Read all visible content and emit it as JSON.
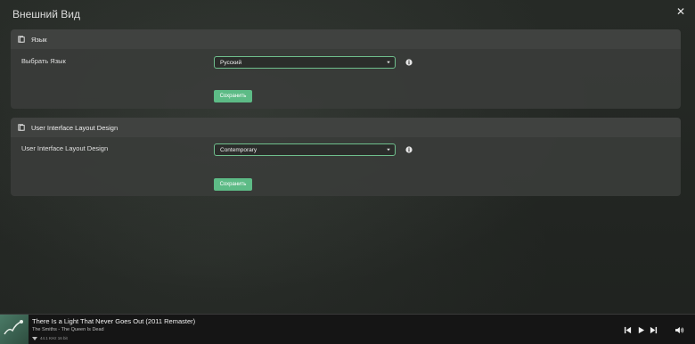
{
  "window": {
    "title": "Внешний Вид"
  },
  "language_panel": {
    "heading": "Язык",
    "field_label": "Выбрать Язык",
    "selected": "Русский",
    "save_label": "Сохранить"
  },
  "layout_panel": {
    "heading": "User Interface Layout Design",
    "field_label": "User Interface Layout Design",
    "selected": "Contemporary",
    "save_label": "Сохранить"
  },
  "player": {
    "track_title": "There Is a Light That Never Goes Out (2011 Remaster)",
    "artist_album": "The Smiths - The Queen Is Dead",
    "format": "44.1 KHz 16 bit"
  },
  "icons": {
    "close": "close-icon",
    "panel": "book-icon",
    "chevron": "chevron-down-icon",
    "info": "info-icon",
    "prev": "previous-icon",
    "play": "play-icon",
    "next": "next-icon",
    "volume": "volume-icon"
  },
  "colors": {
    "accent": "#5dbb86",
    "panel": "#3a3c3a"
  }
}
